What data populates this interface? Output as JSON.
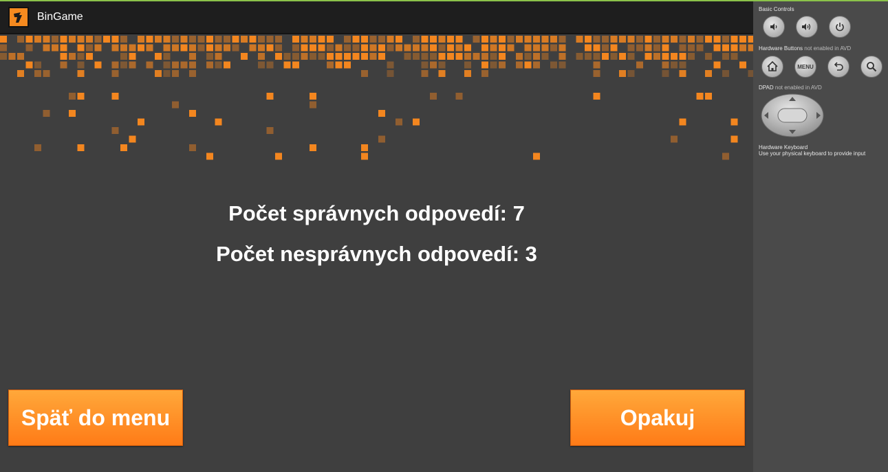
{
  "app": {
    "title": "BinGame",
    "icon": "app-logo-icon"
  },
  "results": {
    "correct": "Počet správnych odpovedí: 7",
    "wrong": "Počet nesprávnych odpovedí: 3"
  },
  "buttons": {
    "back": "Späť do menu",
    "retry": "Opakuj"
  },
  "panel": {
    "basic_controls": "Basic Controls",
    "hardware_buttons": "Hardware Buttons",
    "hardware_buttons_note": "not enabled in AVD",
    "dpad": "DPAD",
    "dpad_note": "not enabled in AVD",
    "keyboard_title": "Hardware Keyboard",
    "keyboard_note": "Use your physical keyboard to provide input",
    "menu_label": "MENU"
  },
  "colors": {
    "accent": "#ff8a1c",
    "screen_bg": "#3f3f3f",
    "actionbar": "#1e1e1e",
    "panel_bg": "#4a4a4a"
  }
}
